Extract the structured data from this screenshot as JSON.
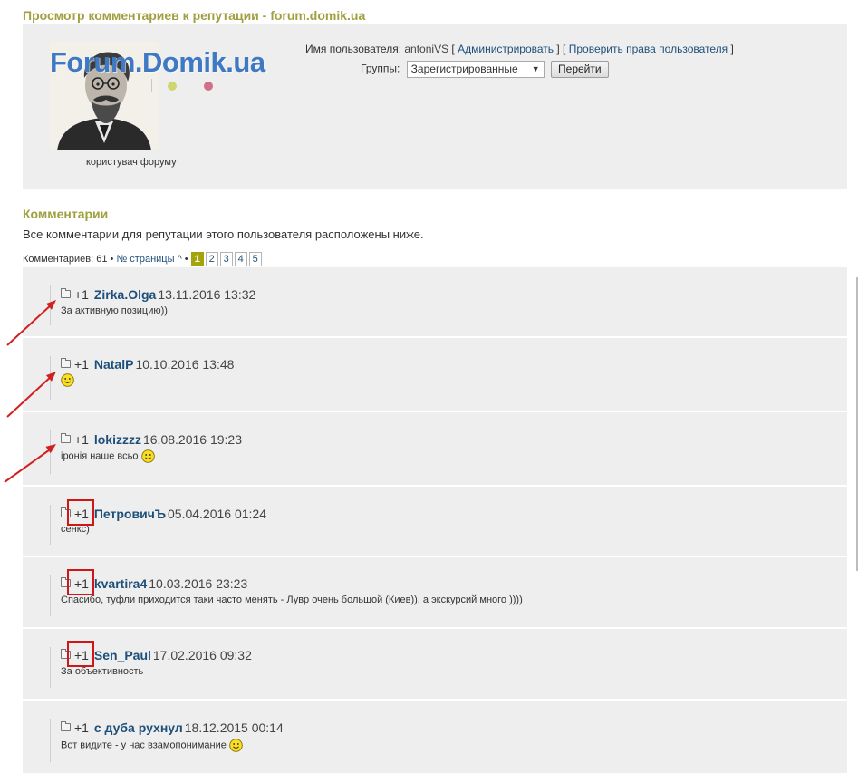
{
  "page": {
    "title": "Просмотр комментариев к репутации - forum.domik.ua"
  },
  "profile": {
    "logo_text": "Forum.Domik.ua",
    "avatar_caption": "користувач форуму",
    "username_label": "Имя пользователя:",
    "username": "antoniVS",
    "admin_link": "Администрировать",
    "check_rights_link": "Проверить права пользователя",
    "groups_label": "Группы:",
    "group_selected": "Зарегистрированные",
    "go_button": "Перейти",
    "logo_dot_colors": [
      "#cfd66f",
      "#d16f88"
    ]
  },
  "comments_section": {
    "title": "Комментарии",
    "description": "Все комментарии для репутации этого пользователя расположены ниже.",
    "count_text": "Комментариев: 61",
    "separator": "•",
    "page_link": "№ страницы",
    "caret": "^",
    "pages": [
      "1",
      "2",
      "3",
      "4",
      "5"
    ],
    "current_page": "1"
  },
  "comments": [
    {
      "rep": "+1",
      "author": "Zirka.Olga",
      "date": "13.11.2016 13:32",
      "text": "За активную позицию))",
      "smiley": false
    },
    {
      "rep": "+1",
      "author": "NatalP",
      "date": "10.10.2016 13:48",
      "text": "",
      "smiley": true
    },
    {
      "rep": "+1",
      "author": "lokizzzz",
      "date": "16.08.2016 19:23",
      "text": "іронія наше всьо",
      "smiley": true
    },
    {
      "rep": "+1",
      "author": "ПетровичЪ",
      "date": "05.04.2016 01:24",
      "text": "сенкс)",
      "smiley": false
    },
    {
      "rep": "+1",
      "author": "kvartira4",
      "date": "10.03.2016 23:23",
      "text": "Спасибо, туфли приходится таки часто менять - Лувр очень большой (Киев)), а экскурсий много ))))",
      "smiley": false
    },
    {
      "rep": "+1",
      "author": "Sen_Paul",
      "date": "17.02.2016 09:32",
      "text": "За объективность",
      "smiley": false
    },
    {
      "rep": "+1",
      "author": "с дуба рухнул",
      "date": "18.12.2015 00:14",
      "text": "Вот видите - у нас взамопонимание",
      "smiley": true
    }
  ],
  "annotations": {
    "arrow_color": "#d02020",
    "box_color": "#d01616"
  }
}
